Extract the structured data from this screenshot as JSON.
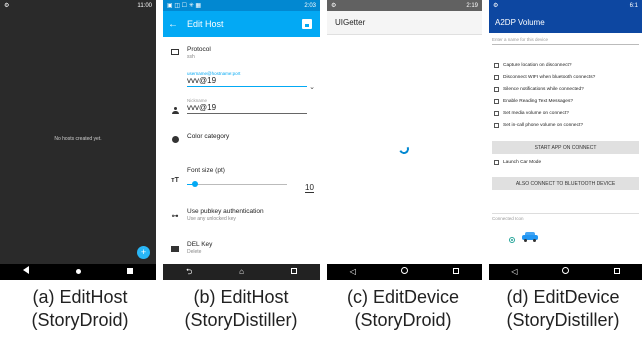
{
  "panel1": {
    "status_time": "11:00",
    "empty_message": "No hosts created yet.",
    "fab_label": "+"
  },
  "panel2": {
    "status_time": "2:03",
    "title": "Edit Host",
    "protocol_label": "Protocol",
    "protocol_value": "ssh",
    "host_hint": "username@hostname:port",
    "host_value": "vvv@19",
    "nickname_hint": "Nickname",
    "nickname_value": "vvv@19",
    "color_label": "Color category",
    "font_label": "Font size (pt)",
    "font_value": "10",
    "font_slider_fraction": 0.08,
    "pubkey_label": "Use pubkey authentication",
    "pubkey_sub": "Use any unlocked key",
    "del_label": "DEL Key",
    "del_sub": "Delete"
  },
  "panel3": {
    "status_time": "2:19",
    "title": "UIGetter"
  },
  "panel4": {
    "status_time": "6:1",
    "title": "A2DP Volume",
    "name_hint": "Enter a name for this device",
    "checkboxes": [
      "Capture location on disconnect?",
      "Disconnect WIFI when bluetooth connects?",
      "Silence notifications while connected?",
      "Enable Reading Text Messages?",
      "Set media volume on connect?",
      "Set in-call phone volume on connect?"
    ],
    "start_button": "START APP ON CONNECT",
    "car_mode": "Launch Car Mode",
    "bt_button": "ALSO CONNECT TO BLUETOOTH DEVICE",
    "connected_icon_hint": "Connected Icon"
  },
  "captions": [
    {
      "line1": "(a) EditHost",
      "line2": "(StoryDroid)"
    },
    {
      "line1": "(b) EditHost",
      "line2": "(StoryDistiller)"
    },
    {
      "line1": "(c) EditDevice",
      "line2": "(StoryDroid)"
    },
    {
      "line1": "(d) EditDevice",
      "line2": "(StoryDistiller)"
    }
  ],
  "colors": {
    "p1_bg": "#2a2a2a",
    "fab": "#29b6f6",
    "edit_host_appbar": "#03a9f4",
    "a2dp_appbar": "#0d47a1"
  }
}
